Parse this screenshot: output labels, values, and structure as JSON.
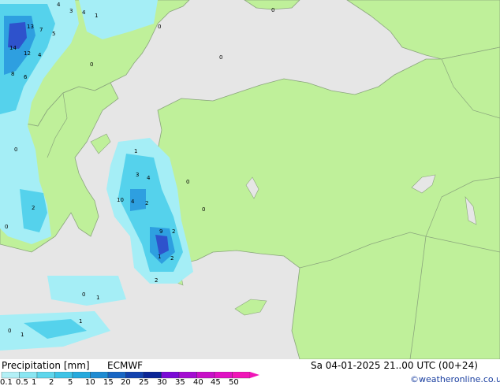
{
  "footer": {
    "title": "Precipitation [mm]",
    "model": "ECMWF",
    "valid_time": "Sa 04-01-2025 21..00 UTC (00+24)",
    "credit": "©weatheronline.co.uk"
  },
  "legend": {
    "ticks": [
      "0.1",
      "0.5",
      "1",
      "2",
      "5",
      "10",
      "15",
      "20",
      "25",
      "30",
      "35",
      "40",
      "45",
      "50"
    ],
    "colors": [
      "#b3f0f6",
      "#8ae6f2",
      "#5fd6ec",
      "#3ec3e6",
      "#26a9dd",
      "#1f8bd2",
      "#1866c4",
      "#1242ae",
      "#0b2596",
      "#7a0bd6",
      "#a40ed2",
      "#c811c8",
      "#e012c4",
      "#f016b8"
    ]
  },
  "map_colors": {
    "sea": "#e6e6e6",
    "land": "#bff09a",
    "border": "#8aa57c",
    "precip_light": "#a5eef6",
    "precip_medium": "#55d2ec",
    "precip_heavy": "#2e9fe0",
    "precip_peak": "#2e52cc"
  },
  "precip_labels": [
    "13",
    "7",
    "5",
    "14",
    "12",
    "4",
    "8",
    "6",
    "0",
    "1",
    "2",
    "3",
    "10",
    "9"
  ]
}
